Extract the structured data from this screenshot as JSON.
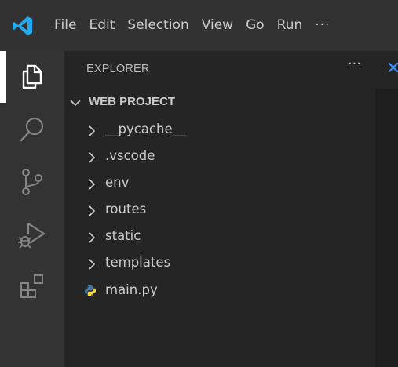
{
  "menu": {
    "items": [
      "File",
      "Edit",
      "Selection",
      "View",
      "Go",
      "Run"
    ],
    "more": "···"
  },
  "activity_bar": {
    "items": [
      {
        "name": "explorer",
        "icon": "files-icon",
        "active": true
      },
      {
        "name": "search",
        "icon": "search-icon",
        "active": false
      },
      {
        "name": "source-control",
        "icon": "source-control-icon",
        "active": false
      },
      {
        "name": "run-debug",
        "icon": "run-debug-icon",
        "active": false
      },
      {
        "name": "extensions",
        "icon": "extensions-icon",
        "active": false
      }
    ]
  },
  "sidebar": {
    "title": "EXPLORER",
    "more": "···",
    "section_title": "WEB PROJECT",
    "folders": [
      "__pycache__",
      ".vscode",
      "env",
      "routes",
      "static",
      "templates"
    ],
    "files": [
      {
        "label": "main.py",
        "icon": "python-file-icon"
      }
    ]
  },
  "colors": {
    "titlebar": "#323233",
    "activity_bar": "#333333",
    "sidebar": "#252526",
    "editor": "#1e1e1e",
    "text": "#cccccc",
    "vscode_blue": "#23a9f2",
    "python_blue": "#3b77a8",
    "python_yellow": "#f7d34a"
  }
}
